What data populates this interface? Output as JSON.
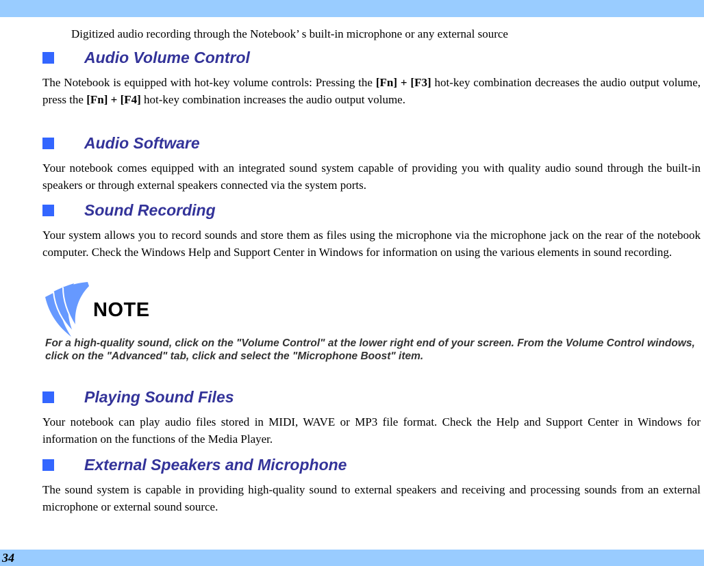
{
  "page": {
    "number": "34",
    "colors": {
      "band": "#99ccff",
      "heading": "#333399",
      "heading_bullet": "#3366ff",
      "arrow": "#ff6600",
      "note_icon": "#6699ff",
      "note_text": "#333333"
    }
  },
  "intro_bullet": {
    "icon": "arrow-bullet-icon",
    "text": "Digitized audio recording through the Notebook’ s built-in microphone or any external source"
  },
  "sections": [
    {
      "heading": "Audio Volume Control",
      "body": {
        "p1": "The Notebook is equipped with hot-key volume controls: Pressing the ",
        "k1": "[Fn] + [F3]",
        "p2": " hot-key combination decreases the audio output volume, press the ",
        "k2": "[Fn] + [F4]",
        "p3": " hot-key combination increases the audio output volume."
      }
    },
    {
      "heading": "Audio Software",
      "body": "Your notebook comes equipped with an integrated sound system capable of providing you with quality audio sound through the built-in speakers or through external speakers connected via the system ports."
    },
    {
      "heading": "Sound Recording",
      "body": "Your system allows you to record sounds and store them as files using the microphone via the microphone jack on the rear of the notebook computer. Check the Windows Help and Support Center in Windows for information on using the various elements in sound recording."
    },
    {
      "heading": "Playing Sound Files",
      "body": "Your notebook can play audio files stored in MIDI, WAVE or MP3 file format. Check the Help and Support Center in Windows for information on the functions of the Media Player."
    },
    {
      "heading": "External Speakers and Microphone",
      "body": "The sound system is capable in providing high-quality sound to external speakers and receiving and processing sounds from an external microphone or external sound source."
    }
  ],
  "note": {
    "icon": "note-pages-icon",
    "label": "NOTE",
    "text": "For a high-quality sound, click on the \"Volume Control\" at the lower right end of your screen.   From the Volume Control windows, click on the \"Advanced\" tab, click and select the \"Microphone Boost\" item."
  }
}
